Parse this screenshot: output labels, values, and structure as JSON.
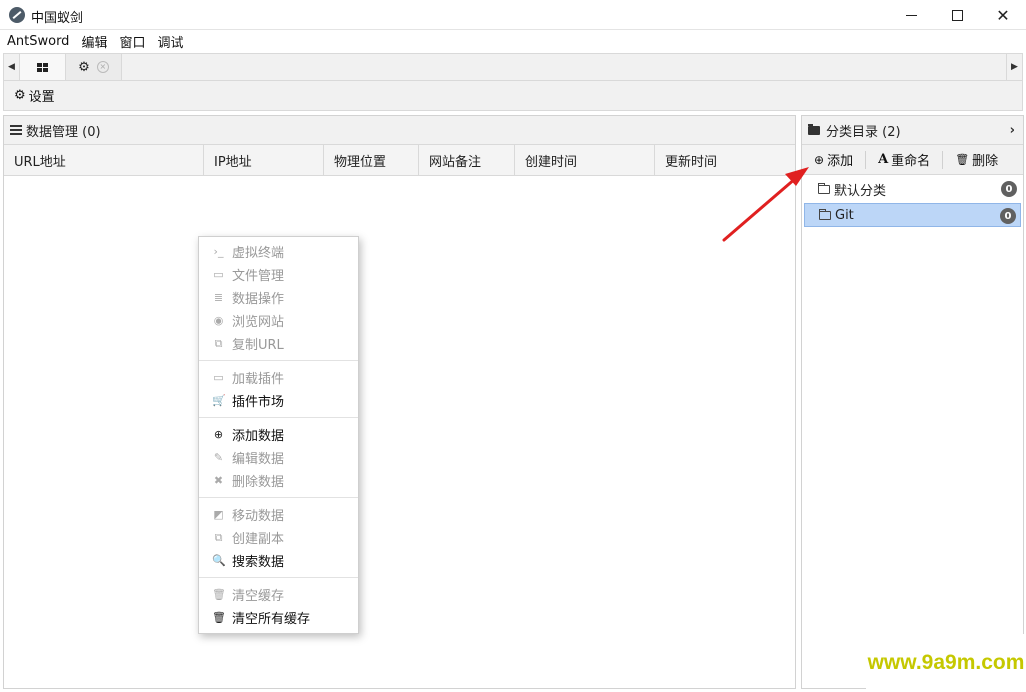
{
  "window": {
    "title": "中国蚁剑",
    "minimize_icon": "minimize-icon",
    "maximize_icon": "maximize-icon",
    "close_glyph": "✕"
  },
  "menubar": {
    "items": [
      "AntSword",
      "编辑",
      "窗口",
      "调试"
    ]
  },
  "tabs": {
    "left_arrow": "◀",
    "right_arrow": "▶",
    "settings_close": "×"
  },
  "toolbar": {
    "settings_label": "设置"
  },
  "data_panel": {
    "title": "数据管理 (0)",
    "columns": [
      "URL地址",
      "IP地址",
      "物理位置",
      "网站备注",
      "创建时间",
      "更新时间"
    ]
  },
  "category_panel": {
    "title": "分类目录 (2)",
    "chevron": "›",
    "buttons": {
      "add": "添加",
      "rename": "重命名",
      "delete": "删除"
    },
    "items": [
      {
        "label": "默认分类",
        "count": "0",
        "selected": false
      },
      {
        "label": "Git",
        "count": "0",
        "selected": true
      }
    ]
  },
  "context_menu": {
    "groups": [
      [
        {
          "label": "虚拟终端",
          "icon": "terminal-icon",
          "enabled": false
        },
        {
          "label": "文件管理",
          "icon": "folder-icon",
          "enabled": false
        },
        {
          "label": "数据操作",
          "icon": "database-icon",
          "enabled": false
        },
        {
          "label": "浏览网站",
          "icon": "chrome-icon",
          "enabled": false
        },
        {
          "label": "复制URL",
          "icon": "copy-icon",
          "enabled": false
        }
      ],
      [
        {
          "label": "加载插件",
          "icon": "folder-icon",
          "enabled": false
        },
        {
          "label": "插件市场",
          "icon": "cart-icon",
          "enabled": true
        }
      ],
      [
        {
          "label": "添加数据",
          "icon": "plus-circle-icon",
          "enabled": true
        },
        {
          "label": "编辑数据",
          "icon": "edit-icon",
          "enabled": false
        },
        {
          "label": "删除数据",
          "icon": "times-icon",
          "enabled": false
        }
      ],
      [
        {
          "label": "移动数据",
          "icon": "share-icon",
          "enabled": false
        },
        {
          "label": "创建副本",
          "icon": "copy-icon",
          "enabled": false
        },
        {
          "label": "搜索数据",
          "icon": "search-icon",
          "enabled": true
        }
      ],
      [
        {
          "label": "清空缓存",
          "icon": "trash-icon",
          "enabled": false
        },
        {
          "label": "清空所有缓存",
          "icon": "trash-icon",
          "enabled": true
        }
      ]
    ]
  },
  "watermark": {
    "text": "www.9a9m.com"
  },
  "colors": {
    "selection_bg": "#bcd6f7",
    "arrow_red": "#e02020",
    "watermark": "#c5c800"
  }
}
